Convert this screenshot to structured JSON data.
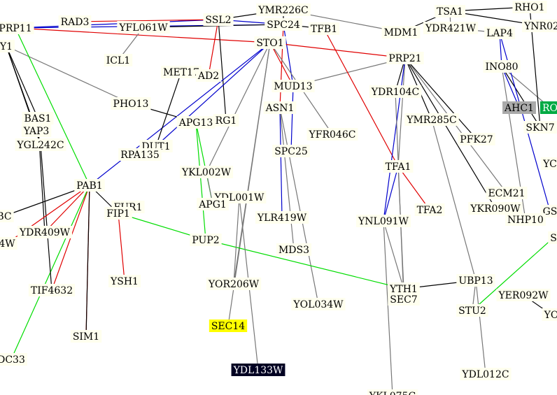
{
  "colors": {
    "background": "#ffffff",
    "node_default": "#ffffee",
    "node_highlight_yellow": "#ffff00",
    "node_highlight_gray": "#aaaaaa",
    "node_highlight_green": "#00aa44",
    "node_highlight_black": "#000022",
    "text_default": "#000000",
    "text_inverse": "#ffffff",
    "edge_black": "#000000",
    "edge_gray": "#777777",
    "edge_red": "#e00000",
    "edge_blue": "#0000cc",
    "edge_green": "#00dd00"
  },
  "nodes": [
    {
      "id": "PRP11",
      "label": "PRP11"
    },
    {
      "id": "RAD3",
      "label": "RAD3"
    },
    {
      "id": "YFL061W",
      "label": "YFL061W"
    },
    {
      "id": "SSL2",
      "label": "SSL2"
    },
    {
      "id": "YMR226C",
      "label": "YMR226C"
    },
    {
      "id": "SPC24",
      "label": "SPC24"
    },
    {
      "id": "TFB1",
      "label": "TFB1"
    },
    {
      "id": "MDM1",
      "label": "MDM1"
    },
    {
      "id": "TSA1",
      "label": "TSA1"
    },
    {
      "id": "YDR421W",
      "label": "YDR421W"
    },
    {
      "id": "RHO1",
      "label": "RHO1"
    },
    {
      "id": "YNR02",
      "label": "YNR02"
    },
    {
      "id": "LAP4",
      "label": "LAP4"
    },
    {
      "id": "Y1",
      "label": "Y1"
    },
    {
      "id": "ICL1",
      "label": "ICL1"
    },
    {
      "id": "STO1",
      "label": "STO1"
    },
    {
      "id": "PRP21",
      "label": "PRP21"
    },
    {
      "id": "INO80",
      "label": "INO80"
    },
    {
      "id": "MET17",
      "label": "MET17"
    },
    {
      "id": "AD2",
      "label": "AD2"
    },
    {
      "id": "MUD13",
      "label": "MUD13"
    },
    {
      "id": "YDR104C",
      "label": "YDR104C"
    },
    {
      "id": "PHO13",
      "label": "PHO13"
    },
    {
      "id": "ASN1",
      "label": "ASN1"
    },
    {
      "id": "AHC1",
      "label": "AHC1",
      "style": "gray"
    },
    {
      "id": "RO",
      "label": "RO",
      "style": "green"
    },
    {
      "id": "BAS1",
      "label": "BAS1"
    },
    {
      "id": "APG13",
      "label": "APG13"
    },
    {
      "id": "RG1",
      "label": "RG1"
    },
    {
      "id": "YMR285C",
      "label": "YMR285C"
    },
    {
      "id": "SKN7",
      "label": "SKN7"
    },
    {
      "id": "YAP3",
      "label": "YAP3"
    },
    {
      "id": "YFR046C",
      "label": "YFR046C"
    },
    {
      "id": "PFK27",
      "label": "PFK27"
    },
    {
      "id": "YGL242C",
      "label": "YGL242C"
    },
    {
      "id": "DUT1",
      "label": "DUT1"
    },
    {
      "id": "RPA135",
      "label": "RPA135"
    },
    {
      "id": "SPC25",
      "label": "SPC25"
    },
    {
      "id": "YC",
      "label": "YC"
    },
    {
      "id": "TFA1",
      "label": "TFA1"
    },
    {
      "id": "YKL002W",
      "label": "YKL002W"
    },
    {
      "id": "PAB1",
      "label": "PAB1"
    },
    {
      "id": "ECM21",
      "label": "ECM21"
    },
    {
      "id": "YDL001W",
      "label": "YDL001W"
    },
    {
      "id": "FUR1",
      "label": "FUR1"
    },
    {
      "id": "APG1",
      "label": "APG1"
    },
    {
      "id": "YKR090W",
      "label": "YKR090W"
    },
    {
      "id": "GS",
      "label": "GS"
    },
    {
      "id": "TFA2",
      "label": "TFA2"
    },
    {
      "id": "FIP1",
      "label": "FIP1"
    },
    {
      "id": "BC",
      "label": "BC"
    },
    {
      "id": "YLR419W",
      "label": "YLR419W"
    },
    {
      "id": "YNL091W",
      "label": "YNL091W"
    },
    {
      "id": "NHP10",
      "label": "NHP10"
    },
    {
      "id": "YDR409W",
      "label": "YDR409W"
    },
    {
      "id": "PUP2",
      "label": "PUP2"
    },
    {
      "id": "S",
      "label": "S"
    },
    {
      "id": "W4",
      "label": "4W"
    },
    {
      "id": "MDS3",
      "label": "MDS3"
    },
    {
      "id": "UBP13",
      "label": "UBP13"
    },
    {
      "id": "YSH1",
      "label": "YSH1"
    },
    {
      "id": "YOR206W",
      "label": "YOR206W"
    },
    {
      "id": "YTH1",
      "label": "YTH1"
    },
    {
      "id": "TIF4632",
      "label": "TIF4632"
    },
    {
      "id": "SEC7",
      "label": "SEC7"
    },
    {
      "id": "YER092W",
      "label": "YER092W"
    },
    {
      "id": "YOL034W",
      "label": "YOL034W"
    },
    {
      "id": "STU2",
      "label": "STU2"
    },
    {
      "id": "YO",
      "label": "YO"
    },
    {
      "id": "SEC14",
      "label": "SEC14",
      "style": "yellow"
    },
    {
      "id": "SIM1",
      "label": "SIM1"
    },
    {
      "id": "DC33",
      "label": "DC33"
    },
    {
      "id": "YDL133W",
      "label": "YDL133W",
      "style": "black"
    },
    {
      "id": "YDL012C",
      "label": "YDL012C"
    },
    {
      "id": "YKL075C",
      "label": "YKL075C"
    }
  ],
  "edges": [
    {
      "from": "PRP11",
      "to": "SSL2",
      "color": "blue"
    },
    {
      "from": "PRP11",
      "to": "STO1",
      "color": "red"
    },
    {
      "from": "PRP11",
      "to": "SPC24",
      "color": "blue"
    },
    {
      "from": "RAD3",
      "to": "SSL2",
      "color": "red"
    },
    {
      "from": "YFL061W",
      "to": "SPC24",
      "color": "black"
    },
    {
      "from": "SSL2",
      "to": "SPC24",
      "color": "blue"
    },
    {
      "from": "SSL2",
      "to": "YMR226C",
      "color": "black"
    },
    {
      "from": "SSL2",
      "to": "AD2",
      "color": "red"
    },
    {
      "from": "SSL2",
      "to": "RG1",
      "color": "black"
    },
    {
      "from": "SPC24",
      "to": "TFB1",
      "color": "black"
    },
    {
      "from": "SPC24",
      "to": "MUD13",
      "color": "blue"
    },
    {
      "from": "SPC24",
      "to": "ASN1",
      "color": "red"
    },
    {
      "from": "STO1",
      "to": "PRP21",
      "color": "red"
    },
    {
      "from": "STO1",
      "to": "DUT1",
      "color": "blue"
    },
    {
      "from": "STO1",
      "to": "PAB1",
      "color": "blue"
    },
    {
      "from": "STO1",
      "to": "MUD13",
      "color": "red"
    },
    {
      "from": "STO1",
      "to": "YFR046C",
      "color": "gray"
    },
    {
      "from": "STO1",
      "to": "YKL002W",
      "color": "gray"
    },
    {
      "from": "STO1",
      "to": "YOR206W",
      "color": "gray"
    },
    {
      "from": "STO1",
      "to": "SEC14",
      "color": "gray"
    },
    {
      "from": "MUD13",
      "to": "PRP21",
      "color": "gray"
    },
    {
      "from": "MUD13",
      "to": "SPC25",
      "color": "blue"
    },
    {
      "from": "ASN1",
      "to": "YLR419W",
      "color": "blue"
    },
    {
      "from": "ASN1",
      "to": "MDS3",
      "color": "gray"
    },
    {
      "from": "ASN1",
      "to": "YOL034W",
      "color": "gray"
    },
    {
      "from": "TFB1",
      "to": "TFA1",
      "color": "red"
    },
    {
      "from": "MDM1",
      "to": "TSA1",
      "color": "black"
    },
    {
      "from": "TSA1",
      "to": "RHO1",
      "color": "black"
    },
    {
      "from": "TSA1",
      "to": "YNR02",
      "color": "black"
    },
    {
      "from": "YDR421W",
      "to": "LAP4",
      "color": "gray"
    },
    {
      "from": "LAP4",
      "to": "INO80",
      "color": "blue"
    },
    {
      "from": "INO80",
      "to": "AHC1",
      "color": "blue"
    },
    {
      "from": "INO80",
      "to": "NHP10",
      "color": "gray"
    },
    {
      "from": "INO80",
      "to": "SKN7",
      "color": "black"
    },
    {
      "from": "INO80",
      "to": "RO",
      "color": "gray"
    },
    {
      "from": "RHO1",
      "to": "SKN7",
      "color": "black"
    },
    {
      "from": "PRP21",
      "to": "YDR104C",
      "color": "black"
    },
    {
      "from": "PRP21",
      "to": "YMR285C",
      "color": "black"
    },
    {
      "from": "PRP21",
      "to": "PFK27",
      "color": "black"
    },
    {
      "from": "PRP21",
      "to": "TFA1",
      "color": "gray"
    },
    {
      "from": "PRP21",
      "to": "ECM21",
      "color": "gray"
    },
    {
      "from": "PRP21",
      "to": "YKR090W",
      "color": "black"
    },
    {
      "from": "PRP21",
      "to": "YNL091W",
      "color": "blue"
    },
    {
      "from": "YMR285C",
      "to": "UBP13",
      "color": "gray"
    },
    {
      "from": "TFA1",
      "to": "TFA2",
      "color": "red"
    },
    {
      "from": "TFA1",
      "to": "YNL091W",
      "color": "blue"
    },
    {
      "from": "TFA1",
      "to": "YTH1",
      "color": "gray"
    },
    {
      "from": "YDR104C",
      "to": "SEC7",
      "color": "gray"
    },
    {
      "from": "YNL091W",
      "to": "YKL075C",
      "color": "gray"
    },
    {
      "from": "YNL091W",
      "to": "YTH1",
      "color": "gray"
    },
    {
      "from": "YTH1",
      "to": "UBP13",
      "color": "black"
    },
    {
      "from": "UBP13",
      "to": "STU2",
      "color": "gray"
    },
    {
      "from": "UBP13",
      "to": "YDL012C",
      "color": "gray"
    },
    {
      "from": "STU2",
      "to": "S",
      "color": "green"
    },
    {
      "from": "YER092W",
      "to": "YO",
      "color": "black"
    },
    {
      "from": "LAP4",
      "to": "GS",
      "color": "blue"
    },
    {
      "from": "Y1",
      "to": "BAS1",
      "color": "black"
    },
    {
      "from": "Y1",
      "to": "YAP3",
      "color": "black"
    },
    {
      "from": "Y1",
      "to": "YGL242C",
      "color": "black"
    },
    {
      "from": "Y1",
      "to": "PHO13",
      "color": "gray"
    },
    {
      "from": "PRP11",
      "to": "PAB1",
      "color": "green"
    },
    {
      "from": "BAS1",
      "to": "YDR409W",
      "color": "black"
    },
    {
      "from": "PAB1",
      "to": "FIP1",
      "color": "black"
    },
    {
      "from": "PAB1",
      "to": "YDR409W",
      "color": "red"
    },
    {
      "from": "PAB1",
      "to": "TIF4632",
      "color": "red"
    },
    {
      "from": "PAB1",
      "to": "SIM1",
      "color": "red"
    },
    {
      "from": "PAB1",
      "to": "DC33",
      "color": "green"
    },
    {
      "from": "PAB1",
      "to": "BC",
      "color": "black"
    },
    {
      "from": "FIP1",
      "to": "YSH1",
      "color": "red"
    },
    {
      "from": "FIP1",
      "to": "FUR1",
      "color": "black"
    },
    {
      "from": "FIP1",
      "to": "PUP2",
      "color": "green"
    },
    {
      "from": "PUP2",
      "to": "YTH1",
      "color": "green"
    },
    {
      "from": "PUP2",
      "to": "APG13",
      "color": "green"
    },
    {
      "from": "APG13",
      "to": "APG1",
      "color": "green"
    },
    {
      "from": "APG13",
      "to": "PHO13",
      "color": "black"
    },
    {
      "from": "DUT1",
      "to": "MET17",
      "color": "black"
    },
    {
      "from": "DUT1",
      "to": "RPA135",
      "color": "black"
    },
    {
      "from": "YKL002W",
      "to": "APG1",
      "color": "gray"
    },
    {
      "from": "YDL001W",
      "to": "YOR206W",
      "color": "gray"
    },
    {
      "from": "YDL001W",
      "to": "YDL133W",
      "color": "gray"
    },
    {
      "from": "YMR226C",
      "to": "SPC24",
      "color": "black"
    },
    {
      "from": "YMR226C",
      "to": "MDM1",
      "color": "gray"
    },
    {
      "from": "TSA1",
      "to": "YDR421W",
      "color": "gray"
    },
    {
      "from": "ICL1",
      "to": "YFL061W",
      "color": "gray"
    },
    {
      "from": "YGL242C",
      "to": "TIF4632",
      "color": "black"
    },
    {
      "from": "W4",
      "to": "PAB1",
      "color": "red"
    },
    {
      "from": "SIM1",
      "to": "PAB1",
      "color": "black"
    }
  ]
}
